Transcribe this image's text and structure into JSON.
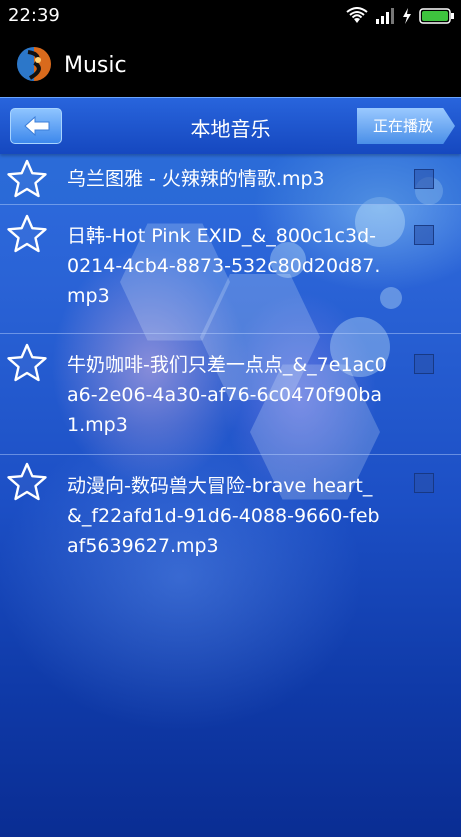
{
  "status_bar": {
    "time": "22:39"
  },
  "action_bar": {
    "title": "Music"
  },
  "header": {
    "title": "本地音乐",
    "now_playing_label": "正在播放"
  },
  "songs": [
    {
      "name": "乌兰图雅 - 火辣辣的情歌.mp3"
    },
    {
      "name": "日韩-Hot Pink EXID_&_800c1c3d-0214-4cb4-8873-532c80d20d87.mp3"
    },
    {
      "name": "牛奶咖啡-我们只差一点点_&_7e1ac0a6-2e06-4a30-af76-6c0470f90ba1.mp3"
    },
    {
      "name": "动漫向-数码兽大冒险-brave heart_&_f22afd1d-91d6-4088-9660-febaf5639627.mp3"
    }
  ],
  "colors": {
    "header_blue": "#2a63d6",
    "accent_green": "#3ec43e",
    "star_outline": "#ffffff"
  }
}
